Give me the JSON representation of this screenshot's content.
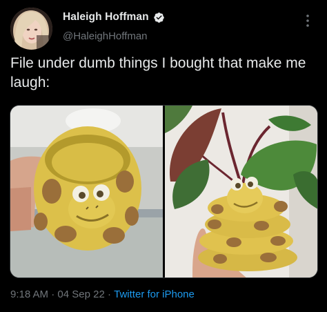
{
  "author": {
    "display_name": "Haleigh Hoffman",
    "handle": "@HaleighHoffman",
    "verified": true
  },
  "tweet": {
    "text": "File under dumb things I bought that make me laugh:"
  },
  "media": {
    "count": 2,
    "images": [
      "snake-planter-empty-photo",
      "snake-planter-with-plant-photo"
    ]
  },
  "meta": {
    "time": "9:18 AM",
    "separator1": " · ",
    "date": "04 Sep 22",
    "separator2": " · ",
    "source": "Twitter for iPhone"
  },
  "icons": {
    "verified": "verified-badge-icon",
    "more": "more-options-icon"
  },
  "colors": {
    "background": "#000000",
    "text_primary": "#e7e9ea",
    "text_secondary": "#71767b",
    "accent": "#1d9bf0"
  }
}
